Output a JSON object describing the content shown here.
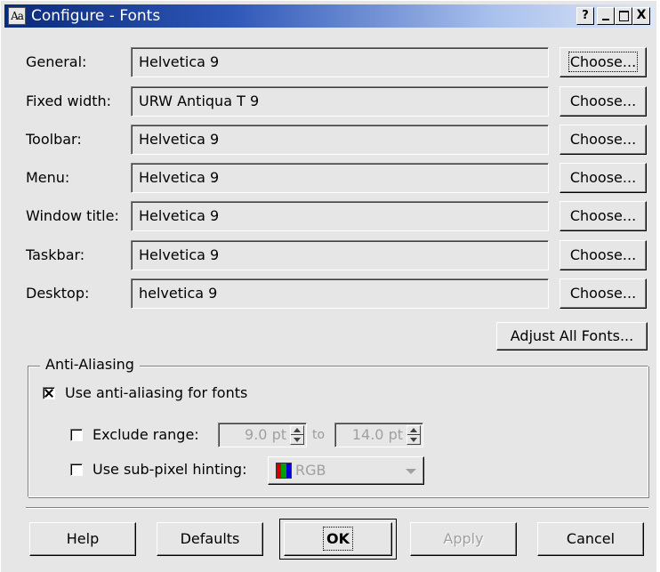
{
  "window": {
    "icon_text": "Aa",
    "title": "Configure - Fonts",
    "title_buttons": [
      "?",
      "_",
      "□",
      "X"
    ]
  },
  "fonts": [
    {
      "label": "General:",
      "value": "Helvetica 9",
      "button": "Choose...",
      "focused": true
    },
    {
      "label": "Fixed width:",
      "value": "URW Antiqua T 9",
      "button": "Choose..."
    },
    {
      "label": "Toolbar:",
      "value": "Helvetica 9",
      "button": "Choose..."
    },
    {
      "label": "Menu:",
      "value": "Helvetica 9",
      "button": "Choose..."
    },
    {
      "label": "Window title:",
      "value": "Helvetica 9",
      "button": "Choose..."
    },
    {
      "label": "Taskbar:",
      "value": "Helvetica 9",
      "button": "Choose..."
    },
    {
      "label": "Desktop:",
      "value": "helvetica 9",
      "button": "Choose..."
    }
  ],
  "adjust_all_label": "Adjust All Fonts...",
  "antialiasing": {
    "group_title": "Anti-Aliasing",
    "use_aa": {
      "label": "Use anti-aliasing for fonts",
      "checked": true
    },
    "exclude_range": {
      "label": "Exclude range:",
      "checked": false,
      "from": "9.0 pt",
      "to_label": "to",
      "to": "14.0 pt"
    },
    "subpixel": {
      "label": "Use sub-pixel hinting:",
      "checked": false,
      "selected": "RGB",
      "icon": "rgb-icon"
    }
  },
  "buttons": {
    "help": "Help",
    "defaults": "Defaults",
    "ok": "OK",
    "apply": "Apply",
    "cancel": "Cancel"
  },
  "colors": {
    "title_gradient_start": "#0a2a7a",
    "title_gradient_end": "#dde7fa",
    "dialog_bg": "#e6e6e6",
    "disabled_text": "#a0a0a0"
  }
}
